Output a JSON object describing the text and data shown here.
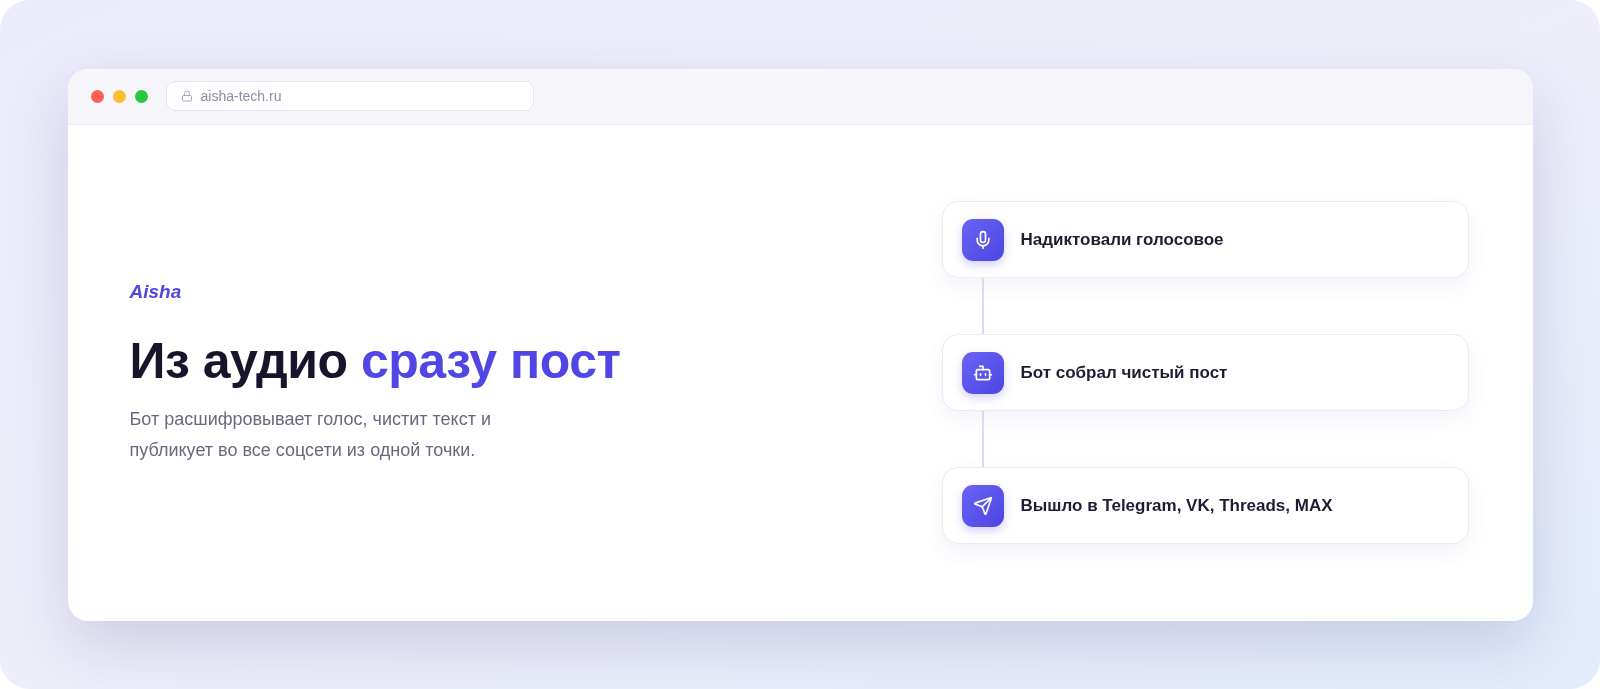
{
  "window": {
    "traffic_lights": [
      {
        "color": "#ff5f57"
      },
      {
        "color": "#febc2e"
      },
      {
        "color": "#28c840"
      }
    ],
    "address_bar": {
      "url": "aisha-tech.ru"
    }
  },
  "hero": {
    "brand": "Aisha",
    "headline": [
      {
        "text": "Из аудио",
        "highlighted": false
      },
      {
        "text": "сразу пост",
        "highlighted": true
      }
    ],
    "description": "Бот расшифровывает голос, чистит текст и публикует во все соцсети из одной точки."
  },
  "steps": [
    {
      "kind": "microphone",
      "text": "Надиктовали голосовое"
    },
    {
      "kind": "robot",
      "text": "Бот собрал чистый пост"
    },
    {
      "kind": "send",
      "text": "Вышло в Telegram, VK, Threads, MAX"
    }
  ]
}
